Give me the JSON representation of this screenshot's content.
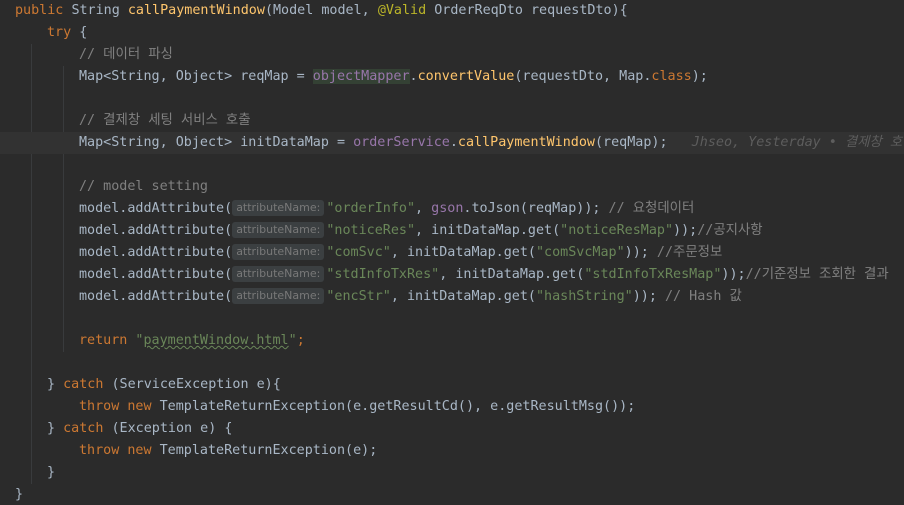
{
  "code": {
    "l1": {
      "kw_public": "public",
      "type_string": "String",
      "method_name": "callPaymentWindow",
      "params_a": "(Model model, ",
      "annotation": "@Valid",
      "params_b": " OrderReqDto requestDto){"
    },
    "l2": {
      "kw_try": "try",
      "brace": " {"
    },
    "l3": {
      "comment": "// 데이터 파싱"
    },
    "l4": {
      "decl": "Map<String, Object> reqMap = ",
      "field": "objectMapper",
      "dot": ".",
      "call": "convertValue",
      "args_a": "(requestDto, Map.",
      "kw_class": "class",
      "args_b": ");"
    },
    "l5": {
      "comment": "// 결제창 세팅 서비스 호출"
    },
    "l6": {
      "decl": "Map<String, Object> initDataMap = ",
      "field": "orderService",
      "dot": ".",
      "call": "callPaymentWindow",
      "args": "(reqMap);",
      "blame": "Jhseo, Yesterday • 결제창 호출"
    },
    "l7": {
      "comment": "// model setting"
    },
    "hint_label": "attributeName:",
    "l8": {
      "pre": "model.addAttribute(",
      "str": "\"orderInfo\"",
      "mid_a": ", ",
      "field": "gson",
      "mid_b": ".toJson(reqMap)); ",
      "comment": "// 요청데이터"
    },
    "l9": {
      "pre": "model.addAttribute(",
      "str": "\"noticeRes\"",
      "mid": ", initDataMap.get(",
      "str2": "\"noticeResMap\"",
      "end": "));",
      "comment": "//공지사항"
    },
    "l10": {
      "pre": "model.addAttribute(",
      "str": "\"comSvc\"",
      "mid": ", initDataMap.get(",
      "str2": "\"comSvcMap\"",
      "end": ")); ",
      "comment": "//주문정보"
    },
    "l11": {
      "pre": "model.addAttribute(",
      "str": "\"stdInfoTxRes\"",
      "mid": ", initDataMap.get(",
      "str2": "\"stdInfoTxResMap\"",
      "end": "));",
      "comment": "//기준정보 조회한 결과"
    },
    "l12": {
      "pre": "model.addAttribute(",
      "str": "\"encStr\"",
      "mid": ", initDataMap.get(",
      "str2": "\"hashString\"",
      "end": ")); ",
      "comment": "// Hash 값"
    },
    "l13": {
      "kw_return": "return",
      "q1": " \"",
      "str": "paymentWindow.html",
      "q2": "\"",
      "end": ";"
    },
    "l14": {
      "brace": "} ",
      "kw_catch": "catch",
      "rest": " (ServiceException e){"
    },
    "l15": {
      "kw_throw": "throw",
      "kw_new": " new",
      "rest": " TemplateReturnException(e.getResultCd(), e.getResultMsg());"
    },
    "l16": {
      "brace": "} ",
      "kw_catch": "catch",
      "rest": " (Exception e) {"
    },
    "l17": {
      "kw_throw": "throw",
      "kw_new": " new",
      "rest": " TemplateReturnException(e);"
    },
    "l18": {
      "brace": "}"
    },
    "l19": {
      "brace": "}"
    }
  },
  "colors": {
    "background": "#2b2b2b",
    "keyword": "#cc7832",
    "method": "#ffc66d",
    "annotation": "#bbb529",
    "comment": "#808080",
    "string": "#6a8759",
    "field": "#9876aa",
    "identifier": "#a9b7c6"
  },
  "icons": {
    "gutter": "lightbulb-icon"
  }
}
